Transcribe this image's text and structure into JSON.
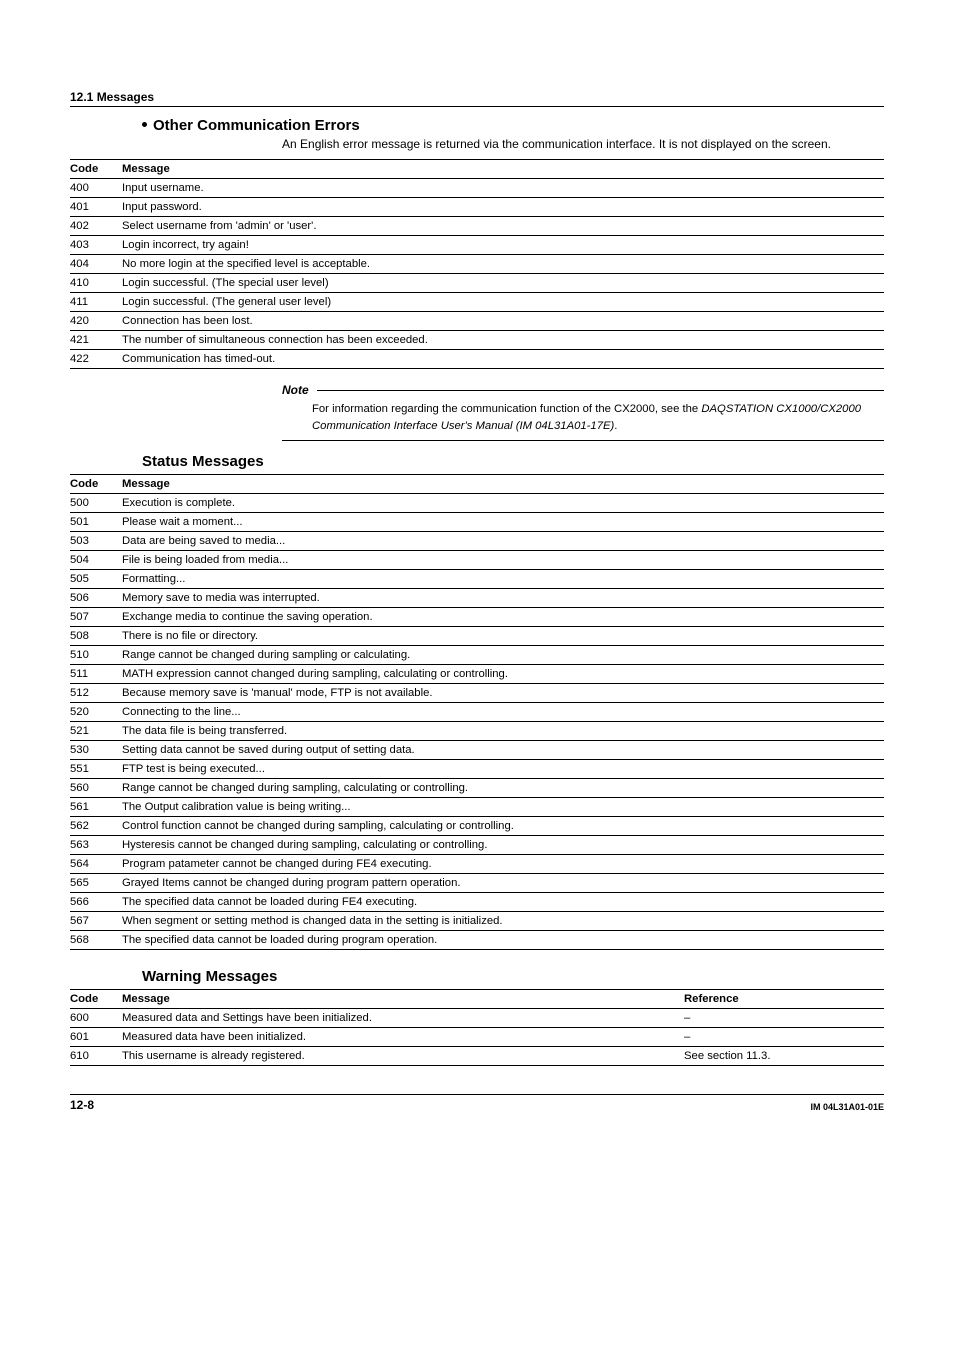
{
  "section_header": "12.1  Messages",
  "other_comm": {
    "title": "Other Communication Errors",
    "intro": "An English error message is returned via the communication interface.  It is not displayed on the screen.",
    "th_code": "Code",
    "th_msg": "Message",
    "rows": [
      {
        "code": "400",
        "msg": "Input username."
      },
      {
        "code": "401",
        "msg": "Input password."
      },
      {
        "code": "402",
        "msg": "Select username from 'admin' or 'user'."
      },
      {
        "code": "403",
        "msg": "Login incorrect, try again!"
      },
      {
        "code": "404",
        "msg": "No more login at the specified level is acceptable."
      },
      {
        "code": "410",
        "msg": "Login successful.  (The special user level)"
      },
      {
        "code": "411",
        "msg": "Login successful.  (The general user level)"
      },
      {
        "code": "420",
        "msg": "Connection has been lost."
      },
      {
        "code": "421",
        "msg": "The number of simultaneous connection has been exceeded."
      },
      {
        "code": "422",
        "msg": "Communication has timed-out."
      }
    ]
  },
  "note": {
    "label": "Note",
    "body_plain": "For information regarding the communication function of the CX2000, see the ",
    "body_italic": "DAQSTATION CX1000/CX2000 Communication Interface User's Manual (IM 04L31A01-17E)",
    "body_trailing": "."
  },
  "status": {
    "title": "Status Messages",
    "th_code": "Code",
    "th_msg": "Message",
    "rows": [
      {
        "code": "500",
        "msg": "Execution is complete."
      },
      {
        "code": "501",
        "msg": "Please wait a moment..."
      },
      {
        "code": "503",
        "msg": "Data are being saved to media..."
      },
      {
        "code": "504",
        "msg": "File is being loaded from media..."
      },
      {
        "code": "505",
        "msg": "Formatting..."
      },
      {
        "code": "506",
        "msg": "Memory save to media was interrupted."
      },
      {
        "code": "507",
        "msg": "Exchange media to continue the saving operation."
      },
      {
        "code": "508",
        "msg": "There is no file or directory."
      },
      {
        "code": "510",
        "msg": "Range cannot be changed during sampling or calculating."
      },
      {
        "code": "511",
        "msg": "MATH expression cannot changed during sampling, calculating or controlling."
      },
      {
        "code": "512",
        "msg": "Because memory save is 'manual' mode, FTP is not available."
      },
      {
        "code": "520",
        "msg": "Connecting to the line..."
      },
      {
        "code": "521",
        "msg": "The data file is being transferred."
      },
      {
        "code": "530",
        "msg": "Setting data cannot be saved during output of setting data."
      },
      {
        "code": "551",
        "msg": "FTP test is being executed..."
      },
      {
        "code": "560",
        "msg": "Range cannot be changed during sampling, calculating or controlling."
      },
      {
        "code": "561",
        "msg": "The Output calibration value is being writing..."
      },
      {
        "code": "562",
        "msg": "Control function cannot be changed during sampling, calculating or controlling."
      },
      {
        "code": "563",
        "msg": "Hysteresis cannot be changed during sampling, calculating or controlling."
      },
      {
        "code": "564",
        "msg": "Program patameter cannot be changed during FE4 executing."
      },
      {
        "code": "565",
        "msg": "Grayed Items cannot be changed during program pattern operation."
      },
      {
        "code": "566",
        "msg": "The specified data cannot be loaded during FE4 executing."
      },
      {
        "code": "567",
        "msg": "When segment or setting method is changed data in the setting is initialized."
      },
      {
        "code": "568",
        "msg": "The specified data cannot be loaded during program operation."
      }
    ]
  },
  "warning": {
    "title": "Warning Messages",
    "th_code": "Code",
    "th_msg": "Message",
    "th_ref": "Reference",
    "rows": [
      {
        "code": "600",
        "msg": "Measured data and Settings have been initialized.",
        "ref": "–"
      },
      {
        "code": "601",
        "msg": "Measured data have been initialized.",
        "ref": "–"
      },
      {
        "code": "610",
        "msg": "This username is already registered.",
        "ref": "See section 11.3."
      }
    ]
  },
  "footer": {
    "page": "12-8",
    "doc_id": "IM 04L31A01-01E"
  }
}
